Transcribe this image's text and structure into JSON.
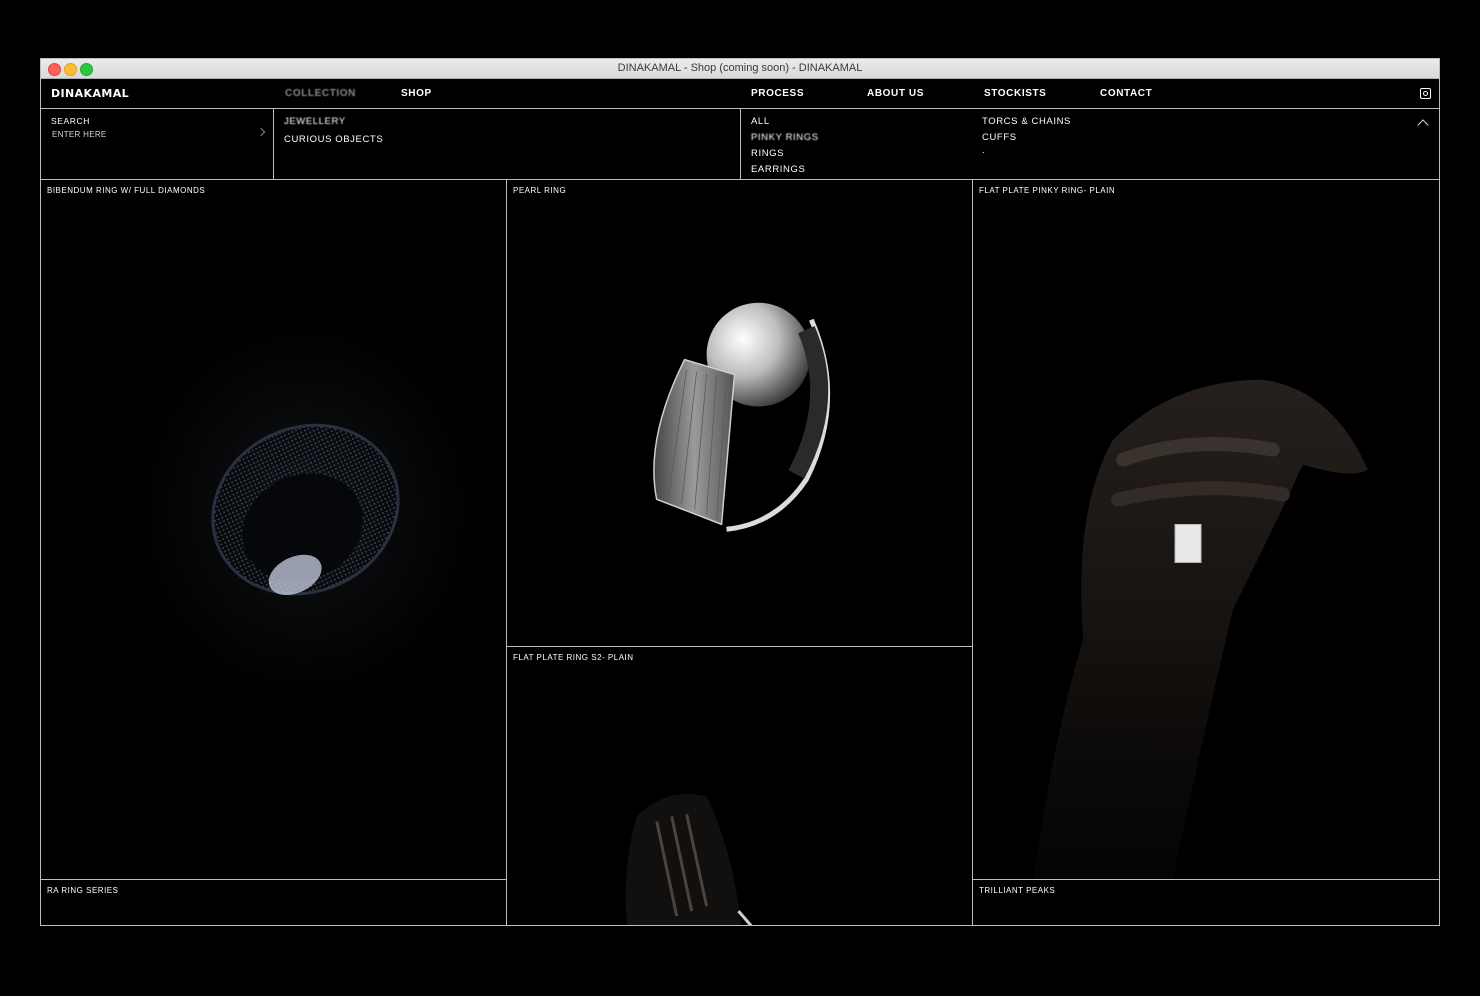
{
  "window": {
    "title": "DINAKAMAL - Shop (coming soon) - DINAKAMAL"
  },
  "nav": {
    "logo": "DINAKAMAL",
    "collection": "COLLECTION",
    "shop": "SHOP",
    "process": "PROCESS",
    "about": "ABOUT US",
    "stockists": "STOCKISTS",
    "contact": "CONTACT",
    "instagram_icon": "instagram-icon"
  },
  "search": {
    "label": "SEARCH",
    "placeholder": "ENTER HERE"
  },
  "categories": {
    "jewellery": "JEWELLERY",
    "curious": "CURIOUS OBJECTS"
  },
  "filters": {
    "col1": [
      "ALL",
      "PINKY RINGS",
      "RINGS",
      "EARRINGS"
    ],
    "col2": [
      "TORCS & CHAINS",
      "CUFFS",
      "."
    ]
  },
  "products": [
    {
      "name": "BIBENDUM RING W/ FULL DIAMONDS"
    },
    {
      "name": "PEARL RING"
    },
    {
      "name": "FLAT PLATE PINKY RING- PLAIN"
    },
    {
      "name": "FLAT PLATE RING S2- PLAIN"
    },
    {
      "name": "RA RING SERIES"
    },
    {
      "name": "TRILLIANT PEAKS"
    }
  ],
  "colors": {
    "background": "#000000",
    "border": "#bdbdbd",
    "text": "#ffffff",
    "muted": "#8a8a8a"
  }
}
